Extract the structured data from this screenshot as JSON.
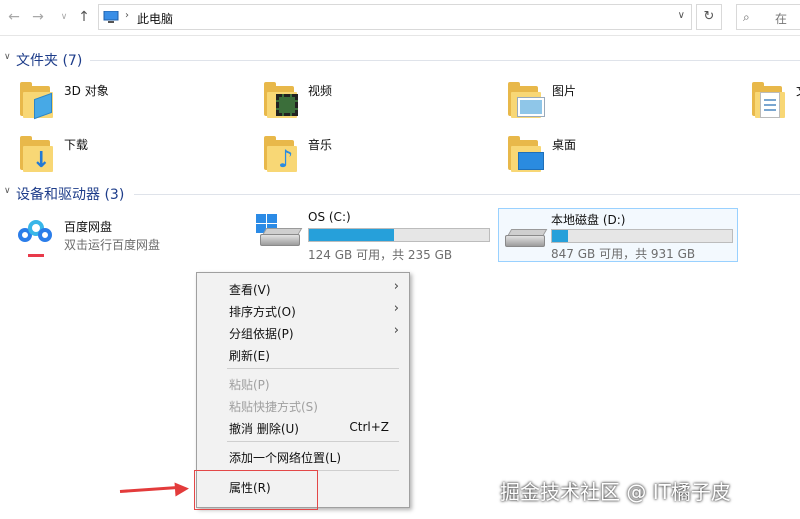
{
  "address": {
    "path": "此电脑",
    "search_placeholder": "在"
  },
  "sections": {
    "folders_title": "文件夹 (7)",
    "devices_title": "设备和驱动器 (3)"
  },
  "folders": [
    {
      "label": "3D 对象",
      "icon": "3d-objects-folder-icon"
    },
    {
      "label": "视频",
      "icon": "videos-folder-icon"
    },
    {
      "label": "图片",
      "icon": "pictures-folder-icon"
    },
    {
      "label": "文",
      "icon": "documents-folder-icon"
    },
    {
      "label": "下载",
      "icon": "downloads-folder-icon"
    },
    {
      "label": "音乐",
      "icon": "music-folder-icon"
    },
    {
      "label": "桌面",
      "icon": "desktop-folder-icon"
    }
  ],
  "devices": {
    "baidu": {
      "name": "百度网盘",
      "subtitle": "双击运行百度网盘"
    },
    "drives": [
      {
        "name": "OS (C:)",
        "free": "124 GB 可用，共 235 GB",
        "used_fraction": 0.47
      },
      {
        "name": "本地磁盘 (D:)",
        "free": "847 GB 可用，共 931 GB",
        "used_fraction": 0.09
      }
    ]
  },
  "context_menu": {
    "items": [
      {
        "label": "查看(V)",
        "submenu": true
      },
      {
        "label": "排序方式(O)",
        "submenu": true
      },
      {
        "label": "分组依据(P)",
        "submenu": true
      },
      {
        "label": "刷新(E)"
      },
      {
        "label": "粘贴(P)",
        "disabled": true
      },
      {
        "label": "粘贴快捷方式(S)",
        "disabled": true
      },
      {
        "label": "撤消 删除(U)",
        "shortcut": "Ctrl+Z"
      },
      {
        "label": "添加一个网络位置(L)"
      },
      {
        "label": "属性(R)"
      }
    ]
  },
  "watermark": "掘金技术社区 @ IT橘子皮",
  "colors": {
    "accent": "#26a0da",
    "annotation": "#e33b3b",
    "section_title": "#1e3d8a"
  }
}
